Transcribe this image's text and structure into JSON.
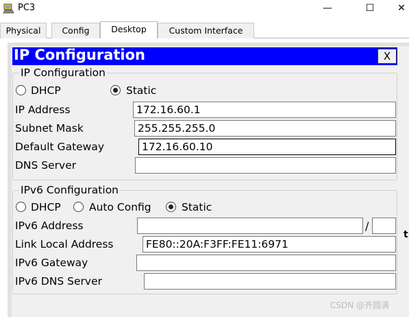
{
  "window": {
    "title": "PC3",
    "minimize_glyph": "—",
    "maximize_glyph": "☐",
    "close_glyph": "✕"
  },
  "tabs": [
    {
      "label": "Physical",
      "active": false
    },
    {
      "label": "Config",
      "active": false
    },
    {
      "label": "Desktop",
      "active": true
    },
    {
      "label": "Custom Interface",
      "active": false
    }
  ],
  "dialog": {
    "title": "IP Configuration",
    "close_label": "X",
    "title_bar_color": "#0000ff"
  },
  "ipv4": {
    "group_label": "IP Configuration",
    "mode": {
      "dhcp_label": "DHCP",
      "static_label": "Static",
      "selected": "Static"
    },
    "ip_address": {
      "label": "IP Address",
      "value": "172.16.60.1"
    },
    "subnet_mask": {
      "label": "Subnet Mask",
      "value": "255.255.255.0"
    },
    "default_gateway": {
      "label": "Default Gateway",
      "value": "172.16.60.10"
    },
    "dns_server": {
      "label": "DNS Server",
      "value": ""
    }
  },
  "ipv6": {
    "group_label": "IPv6 Configuration",
    "mode": {
      "dhcp_label": "DHCP",
      "auto_label": "Auto Config",
      "static_label": "Static",
      "selected": "Static"
    },
    "address": {
      "label": "IPv6 Address",
      "value": "",
      "prefix_separator": "/",
      "prefix": ""
    },
    "link_local": {
      "label": "Link Local Address",
      "value": "FE80::20A:F3FF:FE11:6971"
    },
    "gateway": {
      "label": "IPv6 Gateway",
      "value": ""
    },
    "dns_server": {
      "label": "IPv6 DNS Server",
      "value": ""
    }
  },
  "watermark": "CSDN @齐圆满",
  "edge_text": "t"
}
